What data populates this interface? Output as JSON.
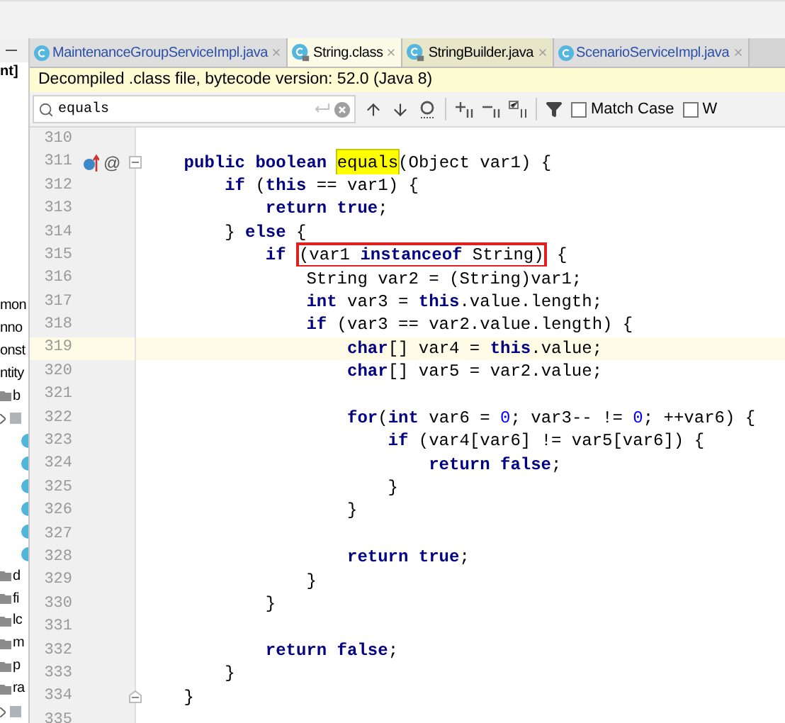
{
  "project_panel": {
    "header_text": "nt]",
    "items": [
      {
        "kind": "text",
        "label": "mon"
      },
      {
        "kind": "text",
        "label": "nno"
      },
      {
        "kind": "text",
        "label": "onst"
      },
      {
        "kind": "text",
        "label": "ntity"
      },
      {
        "kind": "folder",
        "label": "b"
      },
      {
        "kind": "package"
      },
      {
        "kind": "class"
      },
      {
        "kind": "class"
      },
      {
        "kind": "class"
      },
      {
        "kind": "class"
      },
      {
        "kind": "class"
      },
      {
        "kind": "class"
      },
      {
        "kind": "folder",
        "label": "d"
      },
      {
        "kind": "folder",
        "label": "fi"
      },
      {
        "kind": "folder",
        "label": "lc"
      },
      {
        "kind": "folder",
        "label": "m"
      },
      {
        "kind": "folder",
        "label": "p"
      },
      {
        "kind": "folder",
        "label": "ra"
      },
      {
        "kind": "package"
      }
    ]
  },
  "tabs": [
    {
      "label": "MaintenanceGroupServiceImpl.java",
      "kind": "project",
      "selected": false
    },
    {
      "label": "String.class",
      "kind": "library",
      "selected": true
    },
    {
      "label": "StringBuilder.java",
      "kind": "library",
      "selected": false
    },
    {
      "label": "ScenarioServiceImpl.java",
      "kind": "project",
      "selected": false
    }
  ],
  "banner": "Decompiled .class file, bytecode version: 52.0 (Java 8)",
  "search": {
    "value": "equals",
    "options": [
      {
        "label": "Match Case",
        "checked": false
      },
      {
        "label": "W",
        "checked": false
      }
    ]
  },
  "code_lines": [
    {
      "number": "310",
      "kind": "plain",
      "current": false
    },
    {
      "number": "311",
      "kind": "fold_start",
      "current": false,
      "gutter_text": "@",
      "overrides": true,
      "segments": [
        {
          "kind": "kw",
          "text": "public boolean "
        },
        {
          "kind": "match",
          "text": "equals"
        },
        {
          "kind": "plain",
          "text": "(Object var1) {"
        }
      ],
      "children": [
        {
          "number": "312",
          "kind": "plain",
          "current": false,
          "segments": [
            {
              "kind": "kw",
              "text": "if"
            },
            {
              "kind": "plain",
              "text": " ("
            },
            {
              "kind": "kw",
              "text": "this"
            },
            {
              "kind": "plain",
              "text": " == var1) {"
            }
          ],
          "children": [
            {
              "number": "313",
              "kind": "plain",
              "current": false,
              "segments": [
                {
                  "kind": "kw",
                  "text": "return true"
                },
                {
                  "kind": "plain",
                  "text": ";"
                }
              ]
            }
          ]
        },
        {
          "number": "314",
          "kind": "plain",
          "current": false,
          "segments": [
            {
              "kind": "plain",
              "text": "} "
            },
            {
              "kind": "kw",
              "text": "else"
            },
            {
              "kind": "plain",
              "text": " {"
            }
          ],
          "children": [
            {
              "number": "315",
              "kind": "plain",
              "current": false,
              "segments": [
                {
                  "kind": "kw",
                  "text": "if"
                },
                {
                  "kind": "box",
                  "segments": [
                    {
                      "kind": "plain",
                      "text": "(var1 "
                    },
                    {
                      "kind": "kw",
                      "text": "instanceof"
                    },
                    {
                      "kind": "plain",
                      "text": " String)"
                    }
                  ]
                },
                {
                  "kind": "plain",
                  "text": "{"
                }
              ],
              "children": [
                {
                  "number": "316",
                  "kind": "plain",
                  "current": false,
                  "segments": [
                    {
                      "kind": "plain",
                      "text": "String var2 = (String)var1;"
                    }
                  ]
                },
                {
                  "number": "317",
                  "kind": "plain",
                  "current": false,
                  "segments": [
                    {
                      "kind": "kw",
                      "text": "int"
                    },
                    {
                      "kind": "plain",
                      "text": " var3 = "
                    },
                    {
                      "kind": "kw",
                      "text": "this"
                    },
                    {
                      "kind": "plain",
                      "text": ".value.length;"
                    }
                  ]
                },
                {
                  "number": "318",
                  "kind": "plain",
                  "current": false,
                  "segments": [
                    {
                      "kind": "kw",
                      "text": "if"
                    },
                    {
                      "kind": "plain",
                      "text": " (var3 == var2.value.length) {"
                    }
                  ],
                  "children": [
                    {
                      "number": "319",
                      "kind": "plain",
                      "current": true,
                      "segments": [
                        {
                          "kind": "kw",
                          "text": "char"
                        },
                        {
                          "kind": "plain",
                          "text": "[] var4 = "
                        },
                        {
                          "kind": "kw",
                          "text": "this"
                        },
                        {
                          "kind": "plain",
                          "text": ".value;"
                        }
                      ]
                    },
                    {
                      "number": "320",
                      "kind": "plain",
                      "current": false,
                      "segments": [
                        {
                          "kind": "kw",
                          "text": "char"
                        },
                        {
                          "kind": "plain",
                          "text": "[] var5 = var2.value;"
                        }
                      ]
                    },
                    {
                      "number": "321",
                      "kind": "plain",
                      "current": false
                    },
                    {
                      "number": "322",
                      "kind": "plain",
                      "current": false,
                      "segments": [
                        {
                          "kind": "kw",
                          "text": "for"
                        },
                        {
                          "kind": "plain",
                          "text": "("
                        },
                        {
                          "kind": "kw",
                          "text": "int"
                        },
                        {
                          "kind": "plain",
                          "text": " var6 = "
                        },
                        {
                          "kind": "num",
                          "text": "0"
                        },
                        {
                          "kind": "plain",
                          "text": "; var3-- != "
                        },
                        {
                          "kind": "num",
                          "text": "0"
                        },
                        {
                          "kind": "plain",
                          "text": "; ++var6) {"
                        }
                      ],
                      "children": [
                        {
                          "number": "323",
                          "kind": "plain",
                          "current": false,
                          "segments": [
                            {
                              "kind": "kw",
                              "text": "if"
                            },
                            {
                              "kind": "plain",
                              "text": " (var4[var6] != var5[var6]) {"
                            }
                          ],
                          "children": [
                            {
                              "number": "324",
                              "kind": "plain",
                              "current": false,
                              "segments": [
                                {
                                  "kind": "kw",
                                  "text": "return false"
                                },
                                {
                                  "kind": "plain",
                                  "text": ";"
                                }
                              ]
                            }
                          ]
                        },
                        {
                          "number": "325",
                          "kind": "plain",
                          "current": false,
                          "segments": [
                            {
                              "kind": "plain",
                              "text": "}"
                            }
                          ]
                        }
                      ]
                    },
                    {
                      "number": "326",
                      "kind": "plain",
                      "current": false,
                      "segments": [
                        {
                          "kind": "plain",
                          "text": "}"
                        }
                      ]
                    },
                    {
                      "number": "327",
                      "kind": "plain",
                      "current": false
                    },
                    {
                      "number": "328",
                      "kind": "plain",
                      "current": false,
                      "segments": [
                        {
                          "kind": "kw",
                          "text": "return true"
                        },
                        {
                          "kind": "plain",
                          "text": ";"
                        }
                      ]
                    }
                  ]
                },
                {
                  "number": "329",
                  "kind": "plain",
                  "current": false,
                  "segments": [
                    {
                      "kind": "plain",
                      "text": "}"
                    }
                  ]
                }
              ]
            },
            {
              "number": "330",
              "kind": "plain",
              "current": false,
              "segments": [
                {
                  "kind": "plain",
                  "text": "}"
                }
              ]
            },
            {
              "number": "331",
              "kind": "plain",
              "current": false
            },
            {
              "number": "332",
              "kind": "plain",
              "current": false,
              "segments": [
                {
                  "kind": "kw",
                  "text": "return false"
                },
                {
                  "kind": "plain",
                  "text": ";"
                }
              ]
            }
          ]
        },
        {
          "number": "333",
          "kind": "plain",
          "current": false,
          "segments": [
            {
              "kind": "plain",
              "text": "}"
            }
          ]
        }
      ]
    },
    {
      "number": "334",
      "kind": "fold_end",
      "current": false,
      "segments": [
        {
          "kind": "plain",
          "text": "}"
        }
      ]
    },
    {
      "number": "335",
      "kind": "plain",
      "current": false
    }
  ]
}
